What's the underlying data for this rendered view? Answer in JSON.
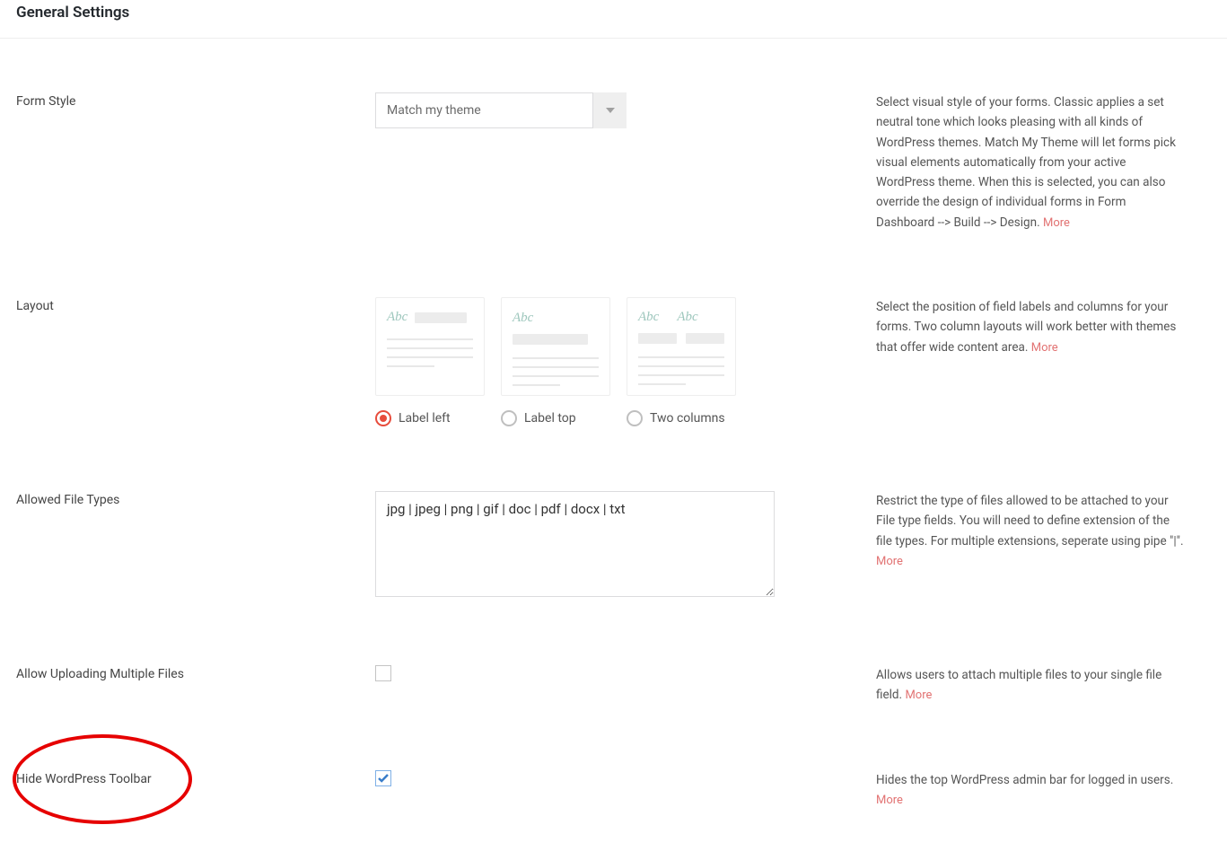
{
  "page_title": "General Settings",
  "more_label": "More",
  "settings": {
    "form_style": {
      "label": "Form Style",
      "selected": "Match my theme",
      "help": "Select visual style of your forms. Classic applies a set neutral tone which looks pleasing with all kinds of WordPress themes. Match My Theme will let forms pick visual elements automatically from your active WordPress theme. When this is selected, you can also override the design of individual forms in Form Dashboard --> Build --> Design. "
    },
    "layout": {
      "label": "Layout",
      "options": [
        {
          "label": "Label left",
          "selected": true
        },
        {
          "label": "Label top",
          "selected": false
        },
        {
          "label": "Two columns",
          "selected": false
        }
      ],
      "abc": "Abc",
      "help": "Select the position of field labels and columns for your forms. Two column layouts will work better with themes that offer wide content area. "
    },
    "allowed_file_types": {
      "label": "Allowed File Types",
      "value": "jpg | jpeg | png | gif | doc | pdf | docx | txt",
      "help": "Restrict the type of files allowed to be attached to your File type fields. You will need to define extension of the file types. For multiple extensions, seperate using pipe \"|\". "
    },
    "allow_multiple": {
      "label": "Allow Uploading Multiple Files",
      "checked": false,
      "help": "Allows users to attach multiple files to your single file field. "
    },
    "hide_toolbar": {
      "label": "Hide WordPress Toolbar",
      "checked": true,
      "help": "Hides the top WordPress admin bar for logged in users. "
    }
  }
}
